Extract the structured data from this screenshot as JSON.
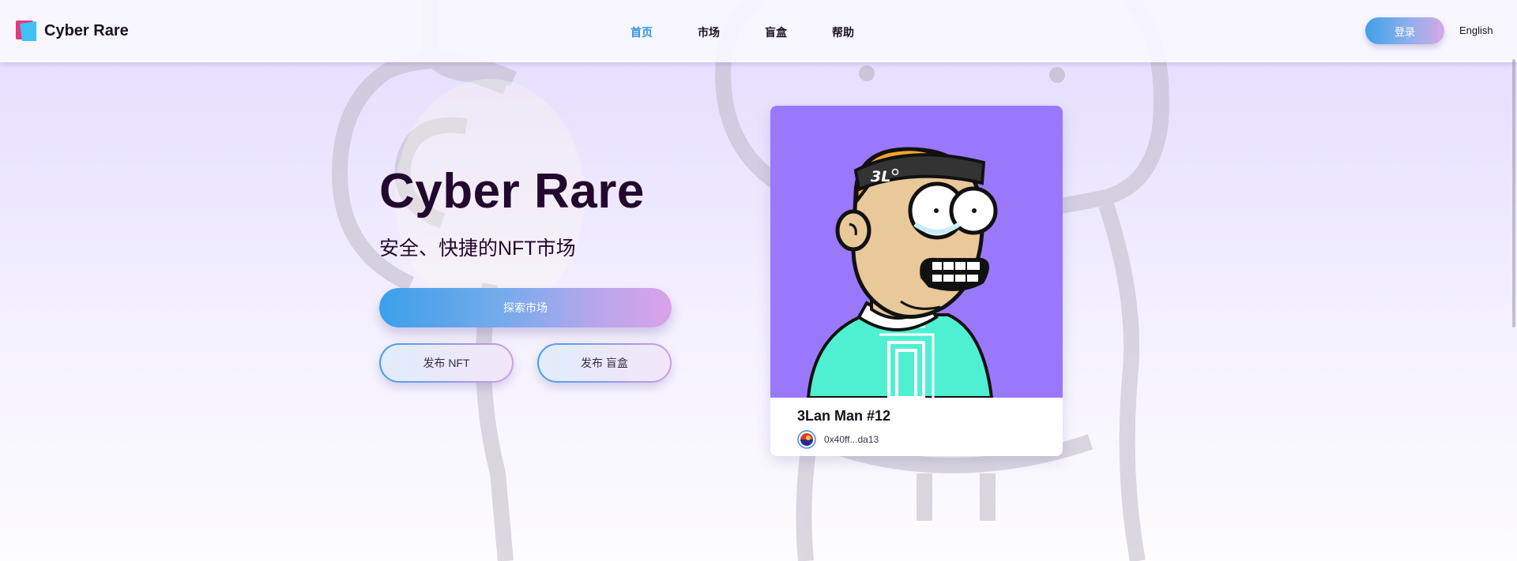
{
  "header": {
    "logo_text": "Cyber Rare",
    "nav": [
      {
        "label": "首页",
        "active": true
      },
      {
        "label": "市场",
        "active": false
      },
      {
        "label": "盲盒",
        "active": false
      },
      {
        "label": "帮助",
        "active": false
      }
    ],
    "login_label": "登录",
    "language_label": "English"
  },
  "hero": {
    "title": "Cyber Rare",
    "subtitle": "安全、快捷的NFT市场",
    "explore_label": "探索市场",
    "publish_nft_label": "发布 NFT",
    "publish_box_label": "发布 盲盒"
  },
  "featured_card": {
    "name": "3Lan Man #12",
    "owner_address": "0x40ff...da13",
    "cap_text": "3L",
    "art_background": "#9a78fc"
  },
  "colors": {
    "accent_blue": "#2f95e8",
    "accent_pink": "#d8a2e8",
    "title_dark": "#22082e"
  },
  "icons": {
    "logo": "cyber-rare-logo-icon",
    "owner": "owner-avatar-icon"
  }
}
